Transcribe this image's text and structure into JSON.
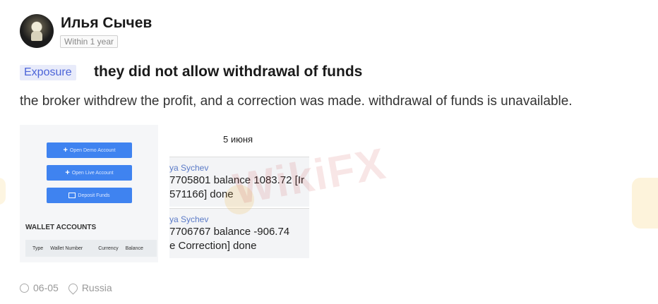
{
  "user": {
    "name": "Илья Сычев",
    "time_badge": "Within 1 year"
  },
  "post": {
    "tag": "Exposure",
    "title": "they did not allow withdrawal of funds",
    "description": "the broker withdrew the profit, and a correction was made. withdrawal of funds is unavailable."
  },
  "screenshot_left": {
    "buttons": [
      "Open Demo Account",
      "Open Live Account",
      "Deposit Funds"
    ],
    "wallet_title": "WALLET ACCOUNTS",
    "table_headers": [
      "Type",
      "Wallet Number",
      "Currency",
      "Balance"
    ]
  },
  "screenshot_right": {
    "date": "5 июня",
    "messages": [
      {
        "name": "ya Sychev",
        "line1": "7705801 balance 1083.72 [Ir",
        "line2": "571166] done"
      },
      {
        "name": "ya Sychev",
        "line1": "7706767 balance -906.74",
        "line2": "e Correction] done"
      }
    ]
  },
  "watermark": "WikiFX",
  "footer": {
    "date": "06-05",
    "location": "Russia"
  }
}
